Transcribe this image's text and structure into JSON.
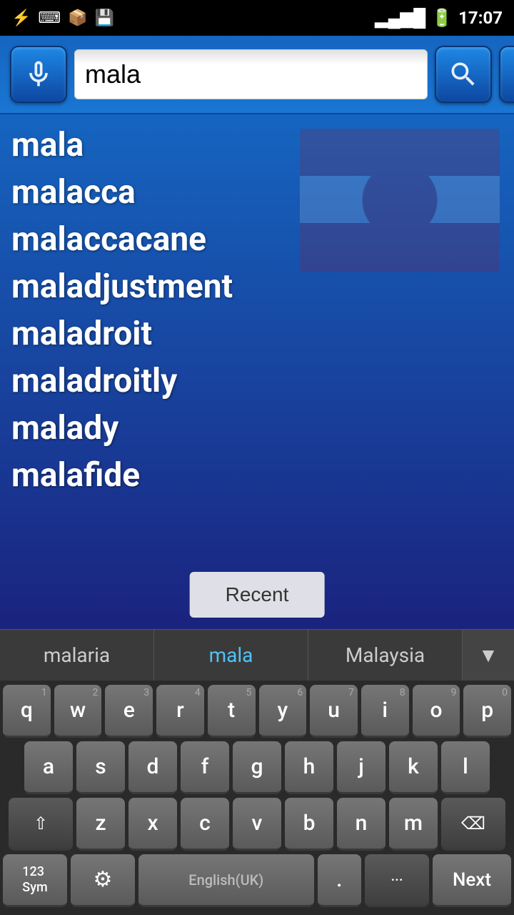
{
  "status": {
    "time": "17:07",
    "battery": "⚡",
    "signal": "▂▄▆█"
  },
  "search": {
    "value": "mala",
    "placeholder": "mala"
  },
  "words": [
    "mala",
    "malacca",
    "malaccacane",
    "maladjustment",
    "maladroit",
    "maladroitly",
    "malady",
    "malafide"
  ],
  "recent_label": "Recent",
  "autocomplete": {
    "left": "malaria",
    "center": "mala",
    "right": "Malaysia"
  },
  "keyboard": {
    "row1": [
      {
        "key": "q",
        "num": "1"
      },
      {
        "key": "w",
        "num": "2"
      },
      {
        "key": "e",
        "num": "3"
      },
      {
        "key": "r",
        "num": "4"
      },
      {
        "key": "t",
        "num": "5"
      },
      {
        "key": "y",
        "num": "6"
      },
      {
        "key": "u",
        "num": "7"
      },
      {
        "key": "i",
        "num": "8"
      },
      {
        "key": "o",
        "num": "9"
      },
      {
        "key": "p",
        "num": "0"
      }
    ],
    "row2": [
      {
        "key": "a"
      },
      {
        "key": "s"
      },
      {
        "key": "d"
      },
      {
        "key": "f"
      },
      {
        "key": "g"
      },
      {
        "key": "h"
      },
      {
        "key": "j"
      },
      {
        "key": "k"
      },
      {
        "key": "l"
      }
    ],
    "row3": [
      {
        "key": "⇧",
        "special": true
      },
      {
        "key": "z"
      },
      {
        "key": "x"
      },
      {
        "key": "c"
      },
      {
        "key": "v"
      },
      {
        "key": "b"
      },
      {
        "key": "n"
      },
      {
        "key": "m"
      },
      {
        "key": "⌫",
        "special": true
      }
    ],
    "row4_left": "123\nSym",
    "row4_settings": "⚙",
    "row4_space": "English(UK)",
    "row4_period": ".",
    "row4_more": "...",
    "row4_next": "Next"
  }
}
